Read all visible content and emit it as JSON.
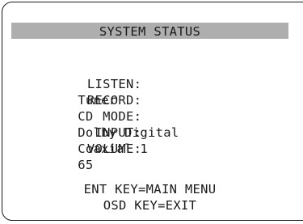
{
  "header": {
    "title": "SYSTEM STATUS"
  },
  "status": {
    "rows": [
      {
        "label": "LISTEN:",
        "value": "Tuner"
      },
      {
        "label": "RECORD:",
        "value": "CD"
      },
      {
        "label": "MODE:",
        "value": "Dolby Digital"
      },
      {
        "label": "INPUT:",
        "value": "Coaxial 1"
      },
      {
        "label": "VOLUME:",
        "value": "65"
      }
    ]
  },
  "footer": {
    "ent_hint": "ENT KEY=MAIN MENU",
    "osd_hint": "OSD KEY=EXIT"
  }
}
